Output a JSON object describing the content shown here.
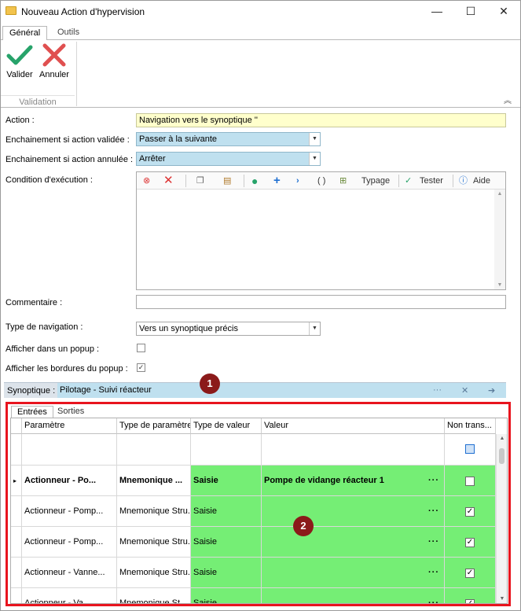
{
  "window": {
    "title": "Nouveau Action d'hypervision",
    "minimize": "—",
    "maximize": "☐",
    "close": "✕"
  },
  "ribbon": {
    "tabs": [
      "Général",
      "Outils"
    ],
    "validate_label": "Valider",
    "cancel_label": "Annuler",
    "group_label": "Validation"
  },
  "form": {
    "action_label": "Action :",
    "action_value": "Navigation vers le synoptique ''",
    "on_valid_label": "Enchainement si action validée :",
    "on_valid_value": "Passer à la suivante",
    "on_cancel_label": "Enchainement si action annulée :",
    "on_cancel_value": "Arrêter",
    "condition_label": "Condition d'exécution :",
    "comment_label": "Commentaire :",
    "comment_value": "",
    "nav_type_label": "Type de navigation :",
    "nav_type_value": "Vers un synoptique précis",
    "popup_label": "Afficher dans un popup :",
    "popup_checked": false,
    "borders_label": "Afficher les bordures du popup :",
    "borders_checked": true,
    "synoptic_label": "Synoptique :",
    "synoptic_value": "Pilotage - Suivi réacteur"
  },
  "condition_toolbar": {
    "typage": "Typage",
    "tester": "Tester",
    "aide": "Aide",
    "parens": "( )"
  },
  "badges": {
    "one": "1",
    "two": "2"
  },
  "subtabs": [
    "Entrées",
    "Sorties"
  ],
  "grid": {
    "columns": [
      "Paramètre",
      "Type de paramètre",
      "Type de valeur",
      "Valeur",
      "Non trans..."
    ],
    "rows": [
      {
        "param": "Actionneur - Po...",
        "ptype": "Mnemonique ...",
        "vtype": "Saisie",
        "value": "Pompe de vidange réacteur 1",
        "dots": "···",
        "nontrans": false
      },
      {
        "param": "Actionneur - Pomp...",
        "ptype": "Mnemonique Stru...",
        "vtype": "Saisie",
        "value": "",
        "dots": "···",
        "nontrans": true
      },
      {
        "param": "Actionneur - Pomp...",
        "ptype": "Mnemonique Stru...",
        "vtype": "Saisie",
        "value": "",
        "dots": "···",
        "nontrans": true
      },
      {
        "param": "Actionneur - Vanne...",
        "ptype": "Mnemonique Stru...",
        "vtype": "Saisie",
        "value": "",
        "dots": "···",
        "nontrans": true
      },
      {
        "param": "Actionneur - Va...",
        "ptype": "Mnemonique St...",
        "vtype": "Saisie",
        "value": "",
        "dots": "···",
        "nontrans": true
      }
    ]
  }
}
